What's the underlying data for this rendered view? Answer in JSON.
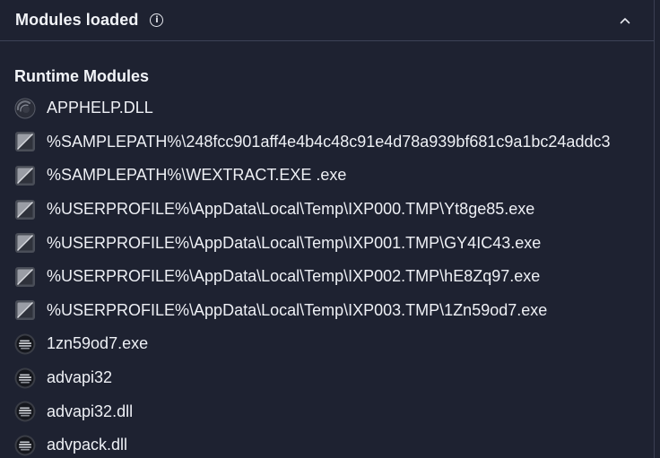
{
  "header": {
    "title": "Modules loaded",
    "info_icon": "info-circle-icon",
    "collapse_icon": "chevron-up-icon"
  },
  "section": {
    "title": "Runtime Modules"
  },
  "modules": [
    {
      "name": "APPHELP.DLL",
      "icon": "system-dll-icon"
    },
    {
      "name": "%SAMPLEPATH%\\248fcc901aff4e4b4c48c91e4d78a939bf681c9a1bc24addc3",
      "icon": "sample-file-icon"
    },
    {
      "name": "%SAMPLEPATH%\\WEXTRACT.EXE .exe",
      "icon": "sample-file-icon"
    },
    {
      "name": "%USERPROFILE%\\AppData\\Local\\Temp\\IXP000.TMP\\Yt8ge85.exe",
      "icon": "sample-file-icon"
    },
    {
      "name": "%USERPROFILE%\\AppData\\Local\\Temp\\IXP001.TMP\\GY4IC43.exe",
      "icon": "sample-file-icon"
    },
    {
      "name": "%USERPROFILE%\\AppData\\Local\\Temp\\IXP002.TMP\\hE8Zq97.exe",
      "icon": "sample-file-icon"
    },
    {
      "name": "%USERPROFILE%\\AppData\\Local\\Temp\\IXP003.TMP\\1Zn59od7.exe",
      "icon": "sample-file-icon"
    },
    {
      "name": "1zn59od7.exe",
      "icon": "module-disc-icon"
    },
    {
      "name": "advapi32",
      "icon": "module-disc-icon"
    },
    {
      "name": "advapi32.dll",
      "icon": "module-disc-icon"
    },
    {
      "name": "advpack.dll",
      "icon": "module-disc-icon"
    }
  ],
  "colors": {
    "background": "#1e2231",
    "text": "#eef0f5",
    "divider": "#3d4256"
  }
}
